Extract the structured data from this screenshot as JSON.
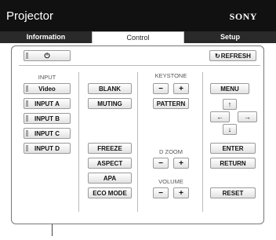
{
  "header": {
    "title": "Projector",
    "brand": "SONY"
  },
  "tabs": [
    {
      "label": "Information",
      "active": false
    },
    {
      "label": "Control",
      "active": true
    },
    {
      "label": "Setup",
      "active": false
    }
  ],
  "toolbar": {
    "power_icon": "⏻",
    "refresh_label": "REFRESH",
    "refresh_icon": "↻"
  },
  "input": {
    "heading": "INPUT",
    "buttons": [
      "Video",
      "INPUT A",
      "INPUT B",
      "INPUT C",
      "INPUT D"
    ]
  },
  "picture": {
    "blank": "BLANK",
    "muting": "MUTING",
    "freeze": "FREEZE",
    "aspect": "ASPECT",
    "apa": "APA",
    "eco_mode": "ECO MODE"
  },
  "keystone": {
    "heading": "KEYSTONE",
    "minus": "−",
    "plus": "+",
    "pattern": "PATTERN"
  },
  "dzoom": {
    "heading": "D ZOOM",
    "minus": "−",
    "plus": "+"
  },
  "volume": {
    "heading": "VOLUME",
    "minus": "−",
    "plus": "+"
  },
  "menu": {
    "menu": "MENU",
    "up": "↑",
    "left": "←",
    "right": "→",
    "down": "↓",
    "enter": "ENTER",
    "return": "RETURN",
    "reset": "RESET"
  },
  "colors": {
    "titlebar": "#111111",
    "tabbar": "#2a2a2a",
    "button_border": "#9a9a9a"
  }
}
